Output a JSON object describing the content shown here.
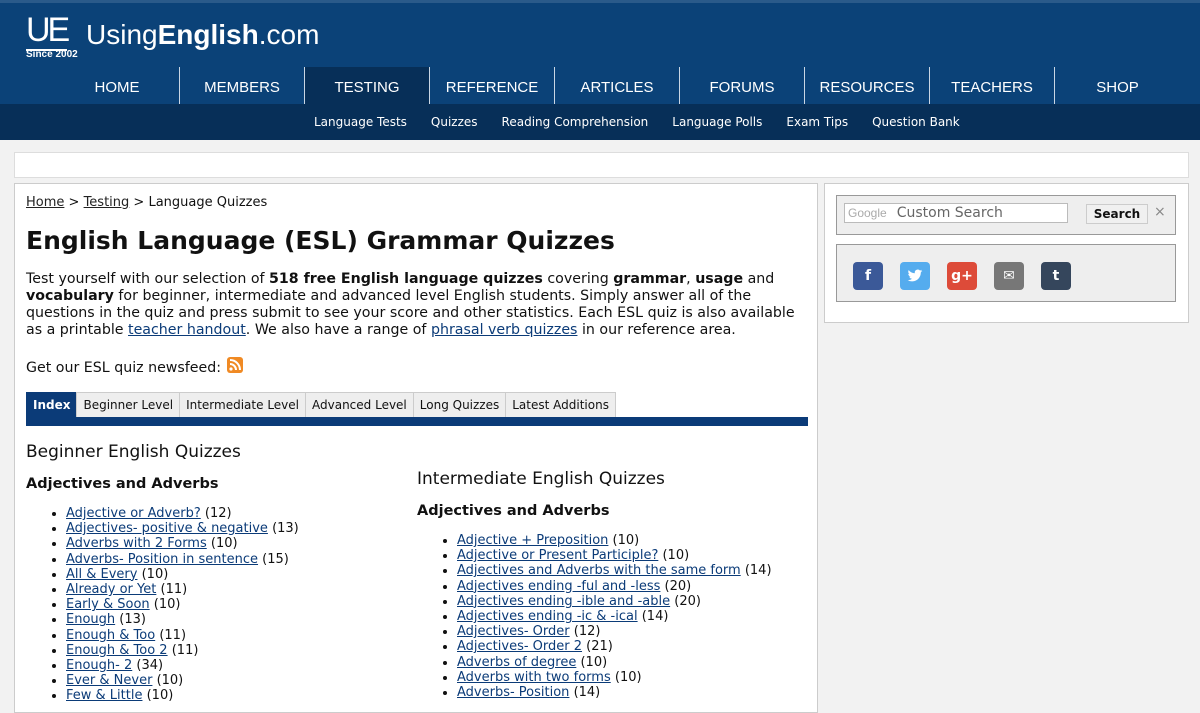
{
  "header": {
    "logo_mark": "UE",
    "logo_since": "Since 2002",
    "logo_prefix": "Using",
    "logo_bold": "English",
    "logo_suffix": ".com"
  },
  "nav": [
    "HOME",
    "MEMBERS",
    "TESTING",
    "REFERENCE",
    "ARTICLES",
    "FORUMS",
    "RESOURCES",
    "TEACHERS",
    "SHOP"
  ],
  "subnav": [
    "Language Tests",
    "Quizzes",
    "Reading Comprehension",
    "Language Polls",
    "Exam Tips",
    "Question Bank"
  ],
  "breadcrumb": {
    "home": "Home",
    "sep": ">",
    "testing": "Testing",
    "current": "Language Quizzes"
  },
  "page": {
    "title": "English Language (ESL) Grammar Quizzes",
    "intro": {
      "t1": "Test yourself with our selection of ",
      "b1": "518 free English language quizzes",
      "t2": " covering ",
      "b2": "grammar",
      "t3": ", ",
      "b3": "usage",
      "t4": " and ",
      "b4": "vocabulary",
      "t5": " for beginner, intermediate and advanced level English students. Simply answer all of the questions in the quiz and press submit to see your score and other statistics. Each ESL quiz is also available as a printable ",
      "l1": "teacher handout",
      "t6": ". We also have a range of ",
      "l2": "phrasal verb quizzes",
      "t7": " in our reference area."
    },
    "newsfeed": "Get our ESL quiz newsfeed:"
  },
  "tabs": [
    "Index",
    "Beginner Level",
    "Intermediate Level",
    "Advanced Level",
    "Long Quizzes",
    "Latest Additions"
  ],
  "beginner": {
    "heading": "Beginner English Quizzes",
    "subheading": "Adjectives and Adverbs",
    "items": [
      {
        "name": "Adjective or Adverb?",
        "count": "(12)"
      },
      {
        "name": "Adjectives- positive & negative",
        "count": "(13)"
      },
      {
        "name": "Adverbs with 2 Forms",
        "count": "(10)"
      },
      {
        "name": "Adverbs- Position in sentence",
        "count": "(15)"
      },
      {
        "name": "All & Every",
        "count": "(10)"
      },
      {
        "name": "Already or Yet",
        "count": "(11)"
      },
      {
        "name": "Early & Soon",
        "count": "(10)"
      },
      {
        "name": "Enough",
        "count": "(13)"
      },
      {
        "name": "Enough & Too",
        "count": "(11)"
      },
      {
        "name": "Enough & Too 2",
        "count": "(11)"
      },
      {
        "name": "Enough- 2",
        "count": "(34)"
      },
      {
        "name": "Ever & Never",
        "count": "(10)"
      },
      {
        "name": "Few & Little",
        "count": "(10)"
      }
    ]
  },
  "intermediate": {
    "heading": "Intermediate English Quizzes",
    "subheading": "Adjectives and Adverbs",
    "items": [
      {
        "name": "Adjective + Preposition",
        "count": "(10)"
      },
      {
        "name": "Adjective or Present Participle?",
        "count": "(10)"
      },
      {
        "name": "Adjectives and Adverbs with the same form",
        "count": "(14)"
      },
      {
        "name": "Adjectives ending -ful and -less",
        "count": "(20)"
      },
      {
        "name": "Adjectives ending -ible and -able",
        "count": "(20)"
      },
      {
        "name": "Adjectives ending -ic & -ical",
        "count": "(14)"
      },
      {
        "name": "Adjectives- Order",
        "count": "(12)"
      },
      {
        "name": "Adjectives- Order 2",
        "count": "(21)"
      },
      {
        "name": "Adverbs of degree",
        "count": "(10)"
      },
      {
        "name": "Adverbs with two forms",
        "count": "(10)"
      },
      {
        "name": "Adverbs- Position",
        "count": "(14)"
      }
    ]
  },
  "sidebar": {
    "google": "Google",
    "search_placeholder": "Custom Search",
    "search_button": "Search",
    "close": "×",
    "share": [
      {
        "icon": "facebook-icon",
        "glyph": "f",
        "color": "#3b5998"
      },
      {
        "icon": "twitter-icon",
        "glyph": "t",
        "color": "#55acee"
      },
      {
        "icon": "google-plus-icon",
        "glyph": "g+",
        "color": "#dd4b39"
      },
      {
        "icon": "email-icon",
        "glyph": "✉",
        "color": "#777777"
      },
      {
        "icon": "tumblr-icon",
        "glyph": "t",
        "color": "#35465c"
      }
    ]
  },
  "colors": {
    "header": "#0b4278",
    "subnav": "#072f58",
    "link": "#0b3b78"
  }
}
